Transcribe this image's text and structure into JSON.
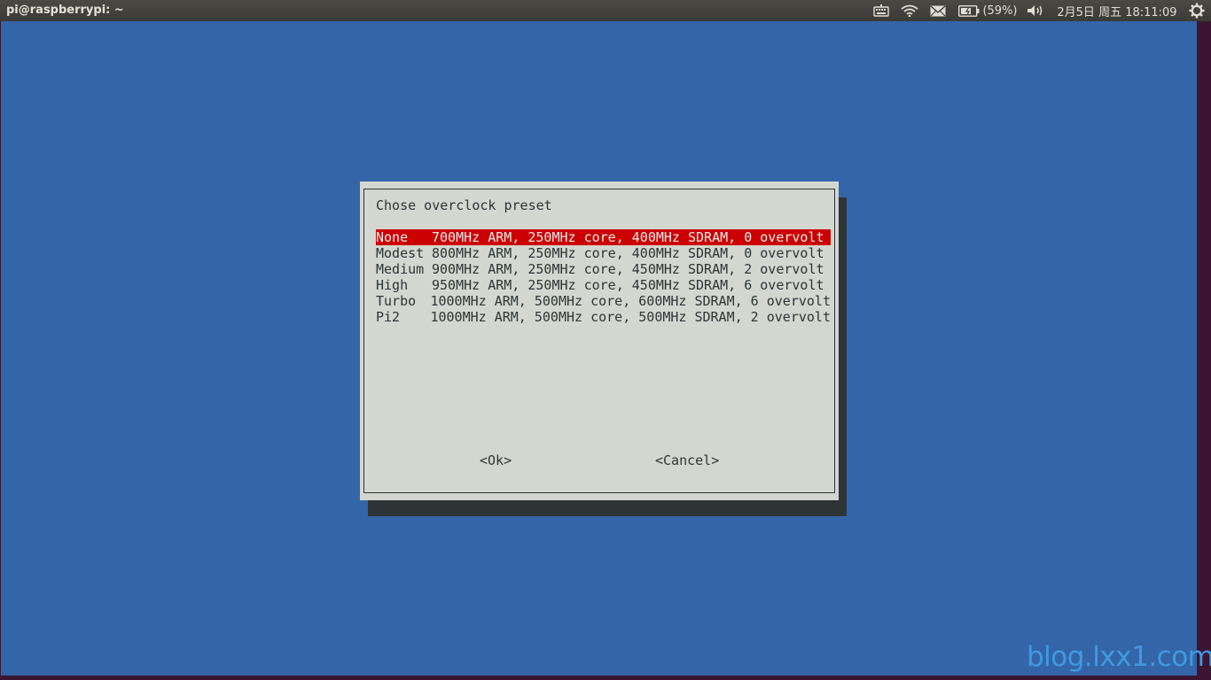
{
  "window": {
    "title": "pi@raspberrypi: ~"
  },
  "tray": {
    "battery_text": "(59%)",
    "datetime": "2月5日 周五 18:11:09",
    "icons": [
      "keyboard-icon",
      "wifi-icon",
      "mail-icon",
      "battery-icon",
      "volume-icon",
      "gear-icon"
    ]
  },
  "dialog": {
    "prompt": "Chose overclock preset",
    "items": [
      {
        "tag": "None",
        "description": "700MHz ARM, 250MHz core, 400MHz SDRAM, 0 overvolt",
        "selected": true
      },
      {
        "tag": "Modest",
        "description": "800MHz ARM, 250MHz core, 400MHz SDRAM, 0 overvolt",
        "selected": false
      },
      {
        "tag": "Medium",
        "description": "900MHz ARM, 250MHz core, 450MHz SDRAM, 2 overvolt",
        "selected": false
      },
      {
        "tag": "High",
        "description": "950MHz ARM, 250MHz core, 450MHz SDRAM, 6 overvolt",
        "selected": false
      },
      {
        "tag": "Turbo",
        "description": "1000MHz ARM, 500MHz core, 600MHz SDRAM, 6 overvolt",
        "selected": false
      },
      {
        "tag": "Pi2",
        "description": "1000MHz ARM, 500MHz core, 500MHz SDRAM, 2 overvolt",
        "selected": false
      }
    ],
    "ok_label": "<Ok>",
    "cancel_label": "<Cancel>"
  },
  "watermark": "blog.lxx1.com",
  "colors": {
    "terminal_background": "#3465a8",
    "dialog_background": "#d3d7cf",
    "selection": "#cc0000",
    "shadow": "#2e3436",
    "watermark": "#3f9ae0"
  }
}
